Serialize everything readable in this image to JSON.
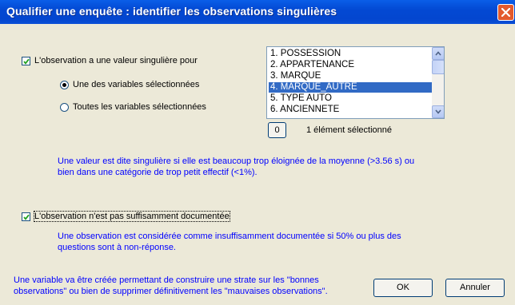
{
  "window": {
    "title": "Qualifier une enquête : identifier les observations singulières"
  },
  "singular": {
    "checkbox_label": "L'observation a une valeur singulière pour",
    "checked": true,
    "radio_one": "Une des variables sélectionnées",
    "radio_all": "Toutes les variables sélectionnées",
    "selected_radio": "one",
    "variables": [
      "1. POSSESSION",
      "2. APPARTENANCE",
      "3. MARQUE",
      "4. MARQUE_AUTRE",
      "5. TYPE AUTO",
      "6. ANCIENNETE"
    ],
    "selected_index": 3,
    "zero_button": "0",
    "selection_count": "1 élément sélectionné",
    "info_line1": "Une valeur est dite singulière si elle est beaucoup trop éloignée de la moyenne (>3.56 s) ou",
    "info_line2": "bien dans une catégorie de trop petit effectif (<1%)."
  },
  "documented": {
    "checkbox_label": "L'observation n'est pas suffisamment documentée",
    "checked": true,
    "info_line1": "Une observation est considérée comme insuffisamment documentée si 50% ou plus des",
    "info_line2": "questions sont à non-réponse."
  },
  "footer": {
    "line1": "Une variable va être créée permettant de construire une strate sur les \"bonnes",
    "line2": "observations\" ou bien de supprimer définitivement les \"mauvaises observations\".",
    "ok_label": "OK",
    "cancel_label": "Annuler"
  },
  "colors": {
    "titlebar": "#0349d3",
    "info_text": "#0000ff",
    "selection": "#316ac5",
    "close": "#e35a2e"
  }
}
